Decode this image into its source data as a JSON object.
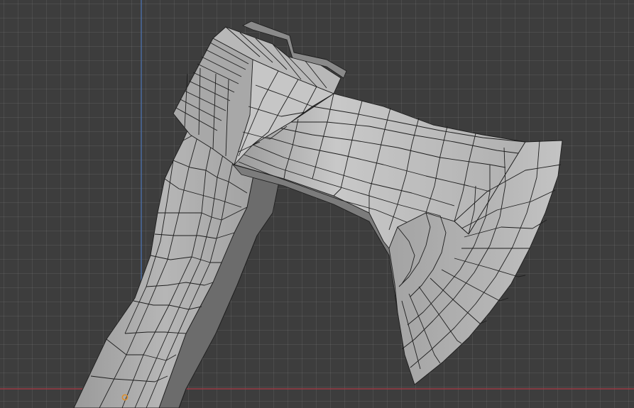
{
  "viewport": {
    "background_color": "#3d3d3d",
    "axis_x_color": "#9c3a45",
    "axis_z_color": "#4c6ea6",
    "origin_color": "#e08f2a",
    "mesh_face_light": "#bdbdbd",
    "mesh_face_mid": "#a4a4a4",
    "mesh_face_dark": "#8c8c8c",
    "mesh_edge_color": "#1e1e1e"
  },
  "scene": {
    "object": "axe mesh",
    "parts": [
      "handle",
      "head-poll",
      "head-neck",
      "blade"
    ]
  }
}
